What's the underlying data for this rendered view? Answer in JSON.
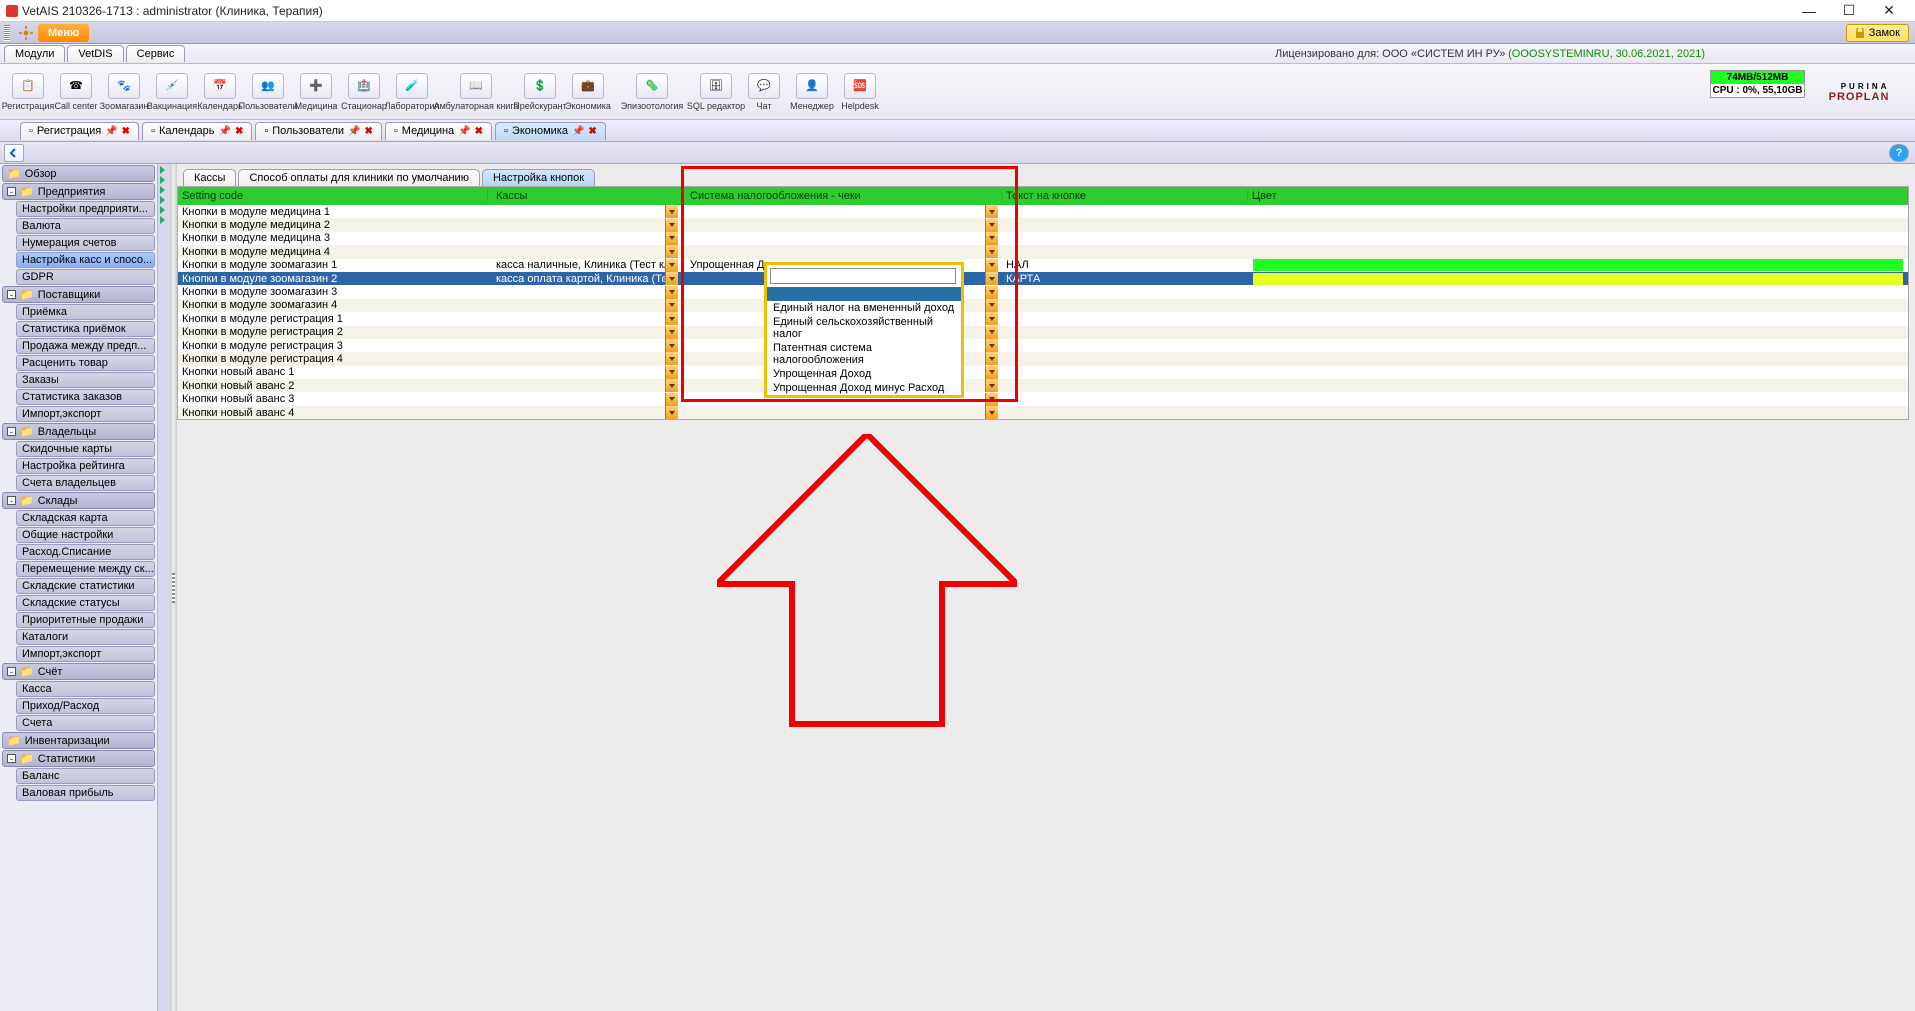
{
  "window": {
    "title": "VetAIS 210326-1713 : administrator (Клиника, Терапия)"
  },
  "menustrip": {
    "menu": "Меню",
    "lock": "Замок"
  },
  "subtabs": {
    "items": [
      "Модули",
      "VetDIS",
      "Сервис"
    ],
    "license_prefix": "Лицензировано для: ООО «СИСТЕМ ИН РУ»",
    "license_suffix": "(OOOSYSTEMINRU, 30.06.2021, 2021)"
  },
  "toolbar": {
    "items": [
      "Регистрация",
      "Call center",
      "Зоомагазин",
      "Вакцинация",
      "Календарь",
      "Пользователи",
      "Медицина",
      "Стационар",
      "Лаборатория",
      "Амбулаторная книга",
      "Прейскурант",
      "Экономика",
      "Эпизоотология",
      "SQL редактор",
      "Чат",
      "Менеджер",
      "Helpdesk"
    ],
    "mem": "74MB/512MB",
    "cpu": "CPU : 0%, 55,10GB",
    "brand_small": "PURINA",
    "brand": "PROPLAN"
  },
  "doctabs": [
    {
      "label": "Регистрация",
      "active": false
    },
    {
      "label": "Календарь",
      "active": false
    },
    {
      "label": "Пользователи",
      "active": false
    },
    {
      "label": "Медицина",
      "active": false
    },
    {
      "label": "Экономика",
      "active": true
    }
  ],
  "sidebar": {
    "sections": [
      {
        "type": "cat",
        "label": "Обзор"
      },
      {
        "type": "cat",
        "label": "Предприятия",
        "expand": true
      },
      {
        "type": "item",
        "label": "Настройки предприяти..."
      },
      {
        "type": "item",
        "label": "Валюта"
      },
      {
        "type": "item",
        "label": "Нумерация счетов"
      },
      {
        "type": "item",
        "label": "Настройка касс и спосо...",
        "active": true
      },
      {
        "type": "item",
        "label": "GDPR"
      },
      {
        "type": "cat",
        "label": "Поставщики",
        "expand": true
      },
      {
        "type": "item",
        "label": "Приёмка"
      },
      {
        "type": "item",
        "label": "Статистика приёмок"
      },
      {
        "type": "item",
        "label": "Продажа между предп..."
      },
      {
        "type": "item",
        "label": "Расценить товар"
      },
      {
        "type": "item",
        "label": "Заказы"
      },
      {
        "type": "item",
        "label": "Статистика заказов"
      },
      {
        "type": "item",
        "label": "Импорт,экспорт"
      },
      {
        "type": "cat",
        "label": "Владельцы",
        "expand": true
      },
      {
        "type": "item",
        "label": "Скидочные карты"
      },
      {
        "type": "item",
        "label": "Настройка рейтинга"
      },
      {
        "type": "item",
        "label": "Счета владельцев"
      },
      {
        "type": "cat",
        "label": "Склады",
        "expand": true
      },
      {
        "type": "item",
        "label": "Складская карта"
      },
      {
        "type": "item",
        "label": "Общие настройки"
      },
      {
        "type": "item",
        "label": "Расход.Списание"
      },
      {
        "type": "item",
        "label": "Перемещение между ск..."
      },
      {
        "type": "item",
        "label": "Складские статистики"
      },
      {
        "type": "item",
        "label": "Складские статусы"
      },
      {
        "type": "item",
        "label": "Приоритетные продажи"
      },
      {
        "type": "item",
        "label": "Каталоги"
      },
      {
        "type": "item",
        "label": "Импорт,экспорт"
      },
      {
        "type": "cat",
        "label": "Счёт",
        "expand": true
      },
      {
        "type": "item",
        "label": "Касса"
      },
      {
        "type": "item",
        "label": "Приход/Расход"
      },
      {
        "type": "item",
        "label": "Счета"
      },
      {
        "type": "cat",
        "label": "Инвентаризации"
      },
      {
        "type": "cat",
        "label": "Статистики",
        "expand": true
      },
      {
        "type": "item",
        "label": "Баланс"
      },
      {
        "type": "item",
        "label": "Валовая прибыль"
      }
    ]
  },
  "inner_tabs": [
    "Кассы",
    "Способ оплаты для клиники по умолчанию",
    "Настройка кнопок"
  ],
  "inner_active": 2,
  "grid": {
    "columns": [
      "Setting code",
      "Кассы",
      "Система налогообложения - чеки",
      "Текст на кнопке",
      "Цвет"
    ],
    "rows": [
      {
        "code": "Кнопки в модуле медицина 1",
        "kassa": "",
        "tax": "",
        "text": "",
        "color": ""
      },
      {
        "code": "Кнопки в модуле медицина 2",
        "kassa": "",
        "tax": "",
        "text": "",
        "color": ""
      },
      {
        "code": "Кнопки в модуле медицина 3",
        "kassa": "",
        "tax": "",
        "text": "",
        "color": ""
      },
      {
        "code": "Кнопки в модуле медицина 4",
        "kassa": "",
        "tax": "",
        "text": "",
        "color": ""
      },
      {
        "code": "Кнопки в модуле зоомагазин 1",
        "kassa": "касса наличные, Клиника (Тест клиника)",
        "tax": "Упрощенная Доход",
        "text": "НАЛ",
        "color": "#21ff21"
      },
      {
        "code": "Кнопки в модуле зоомагазин 2",
        "kassa": "касса оплата картой, Клиника (Тест клиника)",
        "tax": "",
        "text": "КАРТА",
        "color": "#e7ff21",
        "selected": true
      },
      {
        "code": "Кнопки в модуле зоомагазин 3",
        "kassa": "",
        "tax": "",
        "text": "",
        "color": ""
      },
      {
        "code": "Кнопки в модуле зоомагазин 4",
        "kassa": "",
        "tax": "",
        "text": "",
        "color": ""
      },
      {
        "code": "Кнопки в модуле регистрация 1",
        "kassa": "",
        "tax": "",
        "text": "",
        "color": ""
      },
      {
        "code": "Кнопки в модуле регистрация 2",
        "kassa": "",
        "tax": "",
        "text": "",
        "color": ""
      },
      {
        "code": "Кнопки в модуле регистрация 3",
        "kassa": "",
        "tax": "",
        "text": "",
        "color": ""
      },
      {
        "code": "Кнопки в модуле регистрация 4",
        "kassa": "",
        "tax": "",
        "text": "",
        "color": ""
      },
      {
        "code": "Кнопки новый аванс 1",
        "kassa": "",
        "tax": "",
        "text": "",
        "color": ""
      },
      {
        "code": "Кнопки новый аванс 2",
        "kassa": "",
        "tax": "",
        "text": "",
        "color": ""
      },
      {
        "code": "Кнопки новый аванс 3",
        "kassa": "",
        "tax": "",
        "text": "",
        "color": ""
      },
      {
        "code": "Кнопки новый аванс 4",
        "kassa": "",
        "tax": "",
        "text": "",
        "color": ""
      }
    ]
  },
  "dropdown": {
    "input": "",
    "options": [
      "",
      "Единый налог на вмененный доход",
      "Единый сельскохозяйственный налог",
      "Патентная система налогообложения",
      "Упрощенная Доход",
      "Упрощенная Доход минус Расход"
    ],
    "highlighted": 0
  }
}
